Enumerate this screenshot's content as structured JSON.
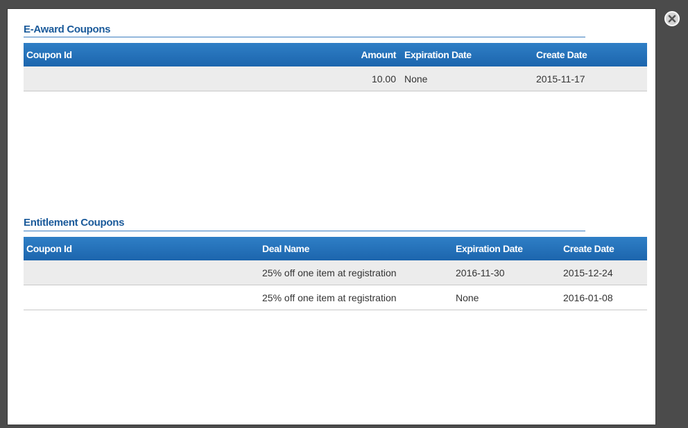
{
  "close_icon": "close-circle-icon",
  "eaward": {
    "title": "E-Award Coupons",
    "headers": {
      "coupon_id": "Coupon Id",
      "amount": "Amount",
      "expiration": "Expiration Date",
      "created": "Create Date"
    },
    "rows": [
      {
        "coupon_id": "",
        "amount": "10.00",
        "expiration": "None",
        "created": "2015-11-17"
      }
    ]
  },
  "entitlement": {
    "title": "Entitlement Coupons",
    "headers": {
      "coupon_id": "Coupon Id",
      "deal": "Deal Name",
      "expiration": "Expiration Date",
      "created": "Create Date"
    },
    "rows": [
      {
        "coupon_id": "",
        "deal": "25% off one item at registration",
        "expiration": "2016-11-30",
        "created": "2015-12-24"
      },
      {
        "coupon_id": "",
        "deal": "25% off one item at registration",
        "expiration": "None",
        "created": "2016-01-08"
      }
    ]
  }
}
